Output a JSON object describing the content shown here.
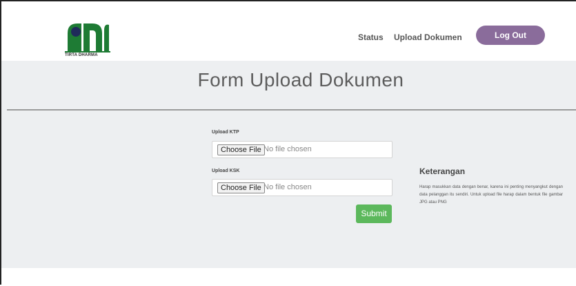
{
  "brand": {
    "logo_text": "TIRTA DHARMA",
    "colors": {
      "green": "#1e7b34",
      "navy": "#1f2a5a"
    }
  },
  "nav": {
    "status_label": "Status",
    "upload_label": "Upload Dokumen",
    "logout_label": "Log Out",
    "logout_color": "#8a6c9b"
  },
  "page": {
    "title": "Form Upload Dokumen"
  },
  "form": {
    "ktp": {
      "label": "Upload KTP",
      "button_label": "Choose File",
      "status_text": "No file chosen"
    },
    "ksk": {
      "label": "Upload KSK",
      "button_label": "Choose File",
      "status_text": "No file chosen"
    },
    "submit_label": "Submit",
    "submit_color": "#5cb85c"
  },
  "info": {
    "title": "Keterangan",
    "text": "Harap masukkan data dengan benar, karena ini penting menyangkut dengan data pelanggan itu sendiri. Untuk upload file harap dalam bentuk file gambar JPG atau PNG"
  }
}
